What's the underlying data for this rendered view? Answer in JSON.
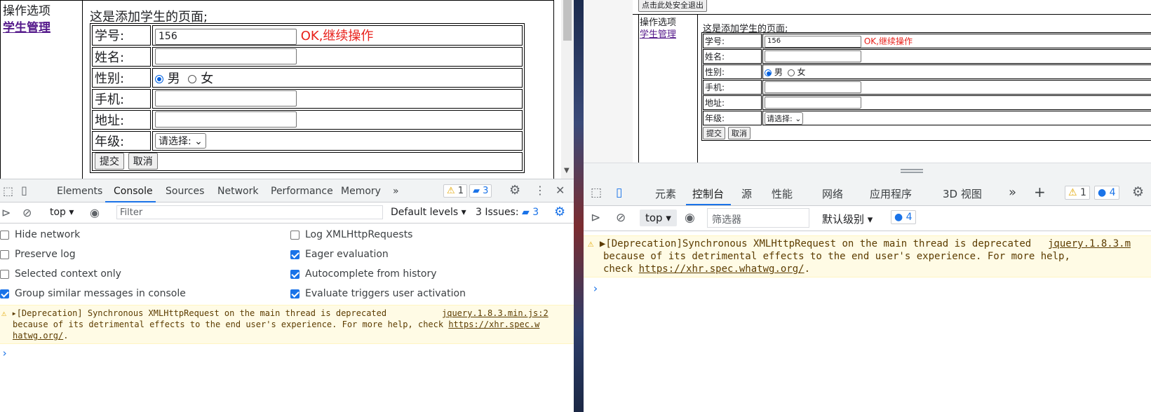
{
  "left": {
    "nav": {
      "title": "操作选项",
      "link": "学生管理"
    },
    "page_heading": "这是添加学生的页面;",
    "form": {
      "rows": [
        {
          "label": "学号:",
          "value": "156",
          "status": "OK,继续操作"
        },
        {
          "label": "姓名:",
          "value": ""
        },
        {
          "label": "性别:"
        },
        {
          "label": "手机:",
          "value": ""
        },
        {
          "label": "地址:",
          "value": ""
        },
        {
          "label": "年级:"
        }
      ],
      "gender_male": "男",
      "gender_female": "女",
      "grade_select": "请选择:",
      "submit": "提交",
      "cancel": "取消"
    },
    "devtools": {
      "tabs": [
        "Elements",
        "Console",
        "Sources",
        "Network",
        "Performance",
        "Memory"
      ],
      "more": "»",
      "warn_count": "1",
      "msg_count": "3",
      "context": "top",
      "filter_placeholder": "Filter",
      "levels": "Default levels",
      "issues": "3 Issues:",
      "issues_count": "3",
      "settings": [
        {
          "label": "Hide network",
          "checked": false
        },
        {
          "label": "Log XMLHttpRequests",
          "checked": false
        },
        {
          "label": "Preserve log",
          "checked": false
        },
        {
          "label": "Eager evaluation",
          "checked": true
        },
        {
          "label": "Selected context only",
          "checked": false
        },
        {
          "label": "Autocomplete from history",
          "checked": true
        },
        {
          "label": "Group similar messages in console",
          "checked": true
        },
        {
          "label": "Evaluate triggers user activation",
          "checked": true
        }
      ],
      "warning": {
        "text1": "[Deprecation] Synchronous XMLHttpRequest on the main thread is deprecated",
        "source": "jquery.1.8.3.min.js:2",
        "text2": "because of its detrimental effects to the end user's experience. For more help, check",
        "link_part1": "https://xhr.spec.w",
        "link_part2": "hatwg.org/",
        "end": "."
      },
      "prompt": "›"
    }
  },
  "right": {
    "top_button": "点击此处安全退出",
    "nav": {
      "title": "操作选项",
      "link": "学生管理"
    },
    "page_heading": "这是添加学生的页面;",
    "form": {
      "rows": [
        {
          "label": "学号:",
          "value": "156",
          "status": "OK,继续操作"
        },
        {
          "label": "姓名:",
          "value": ""
        },
        {
          "label": "性别:"
        },
        {
          "label": "手机:",
          "value": ""
        },
        {
          "label": "地址:",
          "value": ""
        },
        {
          "label": "年级:"
        }
      ],
      "gender_male": "男",
      "gender_female": "女",
      "grade_select": "请选择:",
      "submit": "提交",
      "cancel": "取消"
    },
    "devtools": {
      "tabs": [
        "元素",
        "控制台",
        "源",
        "性能",
        "网络",
        "应用程序",
        "3D 视图"
      ],
      "more": "»",
      "add": "+",
      "warn_count": "1",
      "msg_count": "4",
      "context": "top",
      "filter_placeholder": "筛选器",
      "levels": "默认级别",
      "issues_count": "4",
      "warning": {
        "text1": "[Deprecation]Synchronous XMLHttpRequest on the main thread is deprecated",
        "source": "jquery.1.8.3.m",
        "text2": "because of its detrimental effects to the end user's experience. For more help,",
        "text3": "check",
        "link": "https://xhr.spec.whatwg.org/",
        "end": "."
      },
      "prompt": "›"
    }
  },
  "colors": {
    "ok": "#e8201a",
    "link_visited": "#551a8b",
    "accent": "#1a73e8",
    "warning_bg": "#fffbe5"
  }
}
